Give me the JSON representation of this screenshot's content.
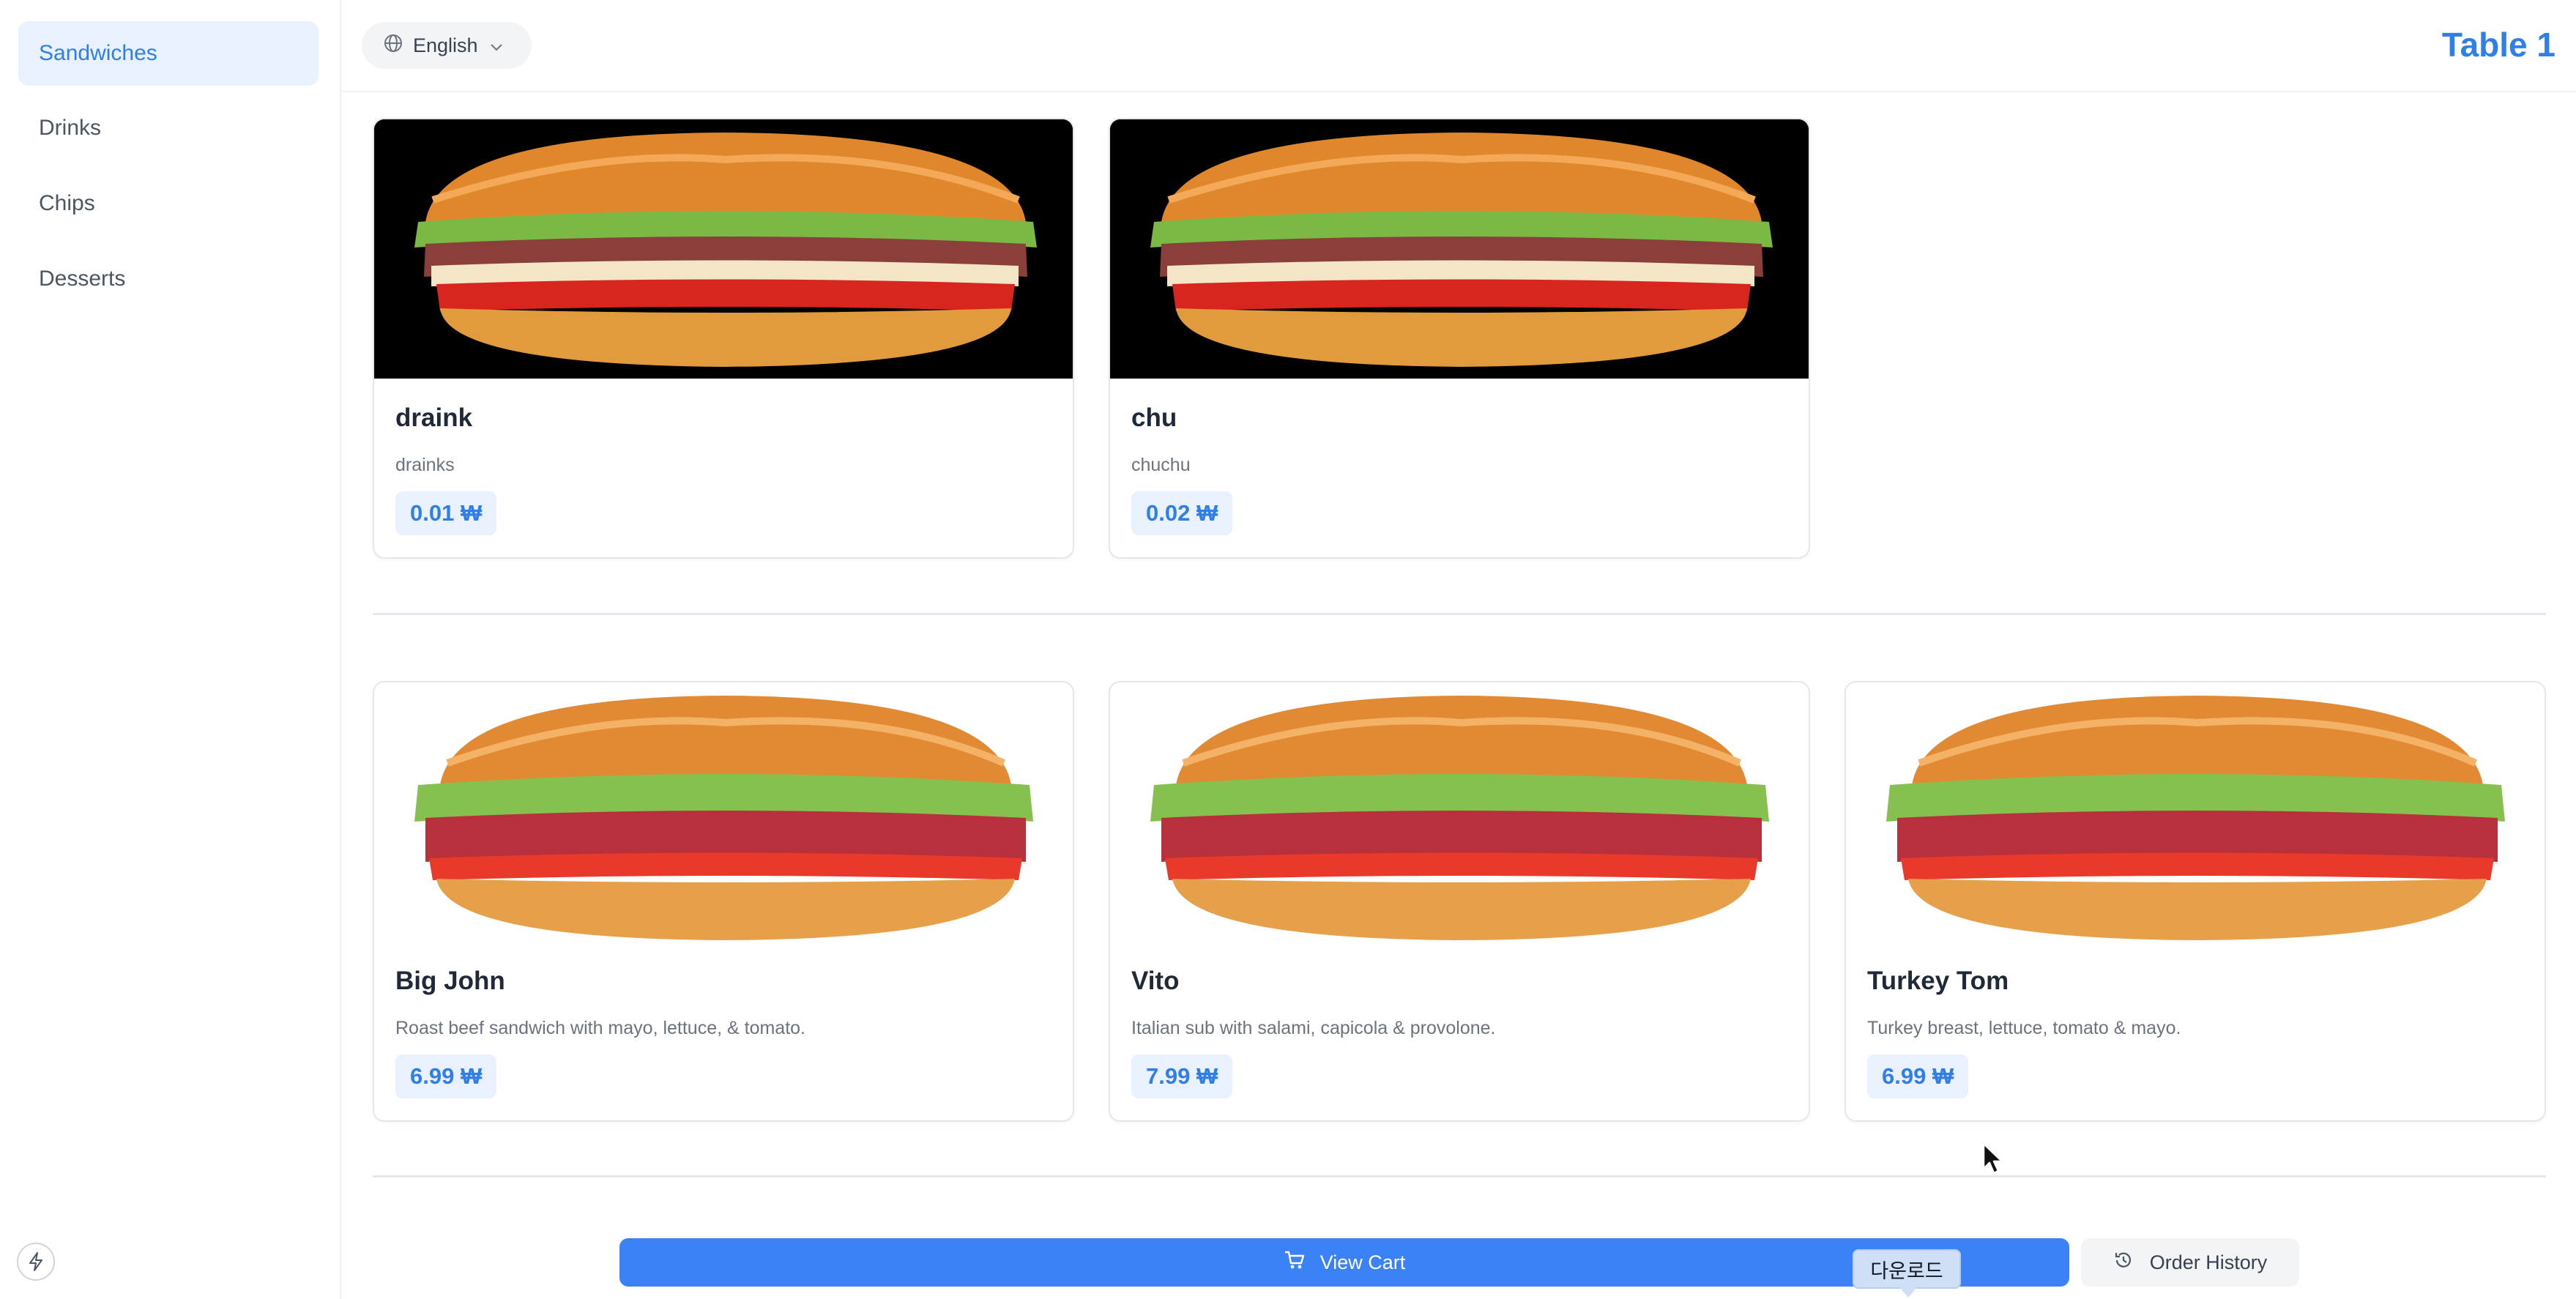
{
  "sidebar": {
    "items": [
      {
        "label": "Sandwiches",
        "active": true
      },
      {
        "label": "Drinks",
        "active": false
      },
      {
        "label": "Chips",
        "active": false
      },
      {
        "label": "Desserts",
        "active": false
      }
    ],
    "footer_icon": "bolt-icon"
  },
  "header": {
    "language": {
      "icon": "globe-icon",
      "value": "English",
      "caret": "chevron-down-icon"
    },
    "table_title": "Table 1"
  },
  "sections": [
    {
      "items": [
        {
          "name": "draink",
          "description": "drainks",
          "price": "0.01 ₩",
          "image": "sandwich-photo-dark-bg"
        },
        {
          "name": "chu",
          "description": "chuchu",
          "price": "0.02 ₩",
          "image": "sandwich-photo-dark-bg"
        }
      ]
    },
    {
      "items": [
        {
          "name": "Big John",
          "description": "Roast beef sandwich with mayo, lettuce, & tomato.",
          "price": "6.99 ₩",
          "image": "sandwich-photo-white-bg"
        },
        {
          "name": "Vito",
          "description": "Italian sub with salami, capicola & provolone.",
          "price": "7.99 ₩",
          "image": "sandwich-photo-white-bg"
        },
        {
          "name": "Turkey Tom",
          "description": "Turkey breast, lettuce, tomato & mayo.",
          "price": "6.99 ₩",
          "image": "sandwich-photo-white-bg"
        }
      ]
    }
  ],
  "bottom_bar": {
    "view_cart_label": "View Cart",
    "view_cart_icon": "cart-icon",
    "order_history_label": "Order History",
    "order_history_icon": "history-icon",
    "tooltip": "다운로드"
  },
  "colors": {
    "accent": "#2f7fe6",
    "accent_light": "#e8f1fd",
    "button_blue": "#3b82f6"
  }
}
